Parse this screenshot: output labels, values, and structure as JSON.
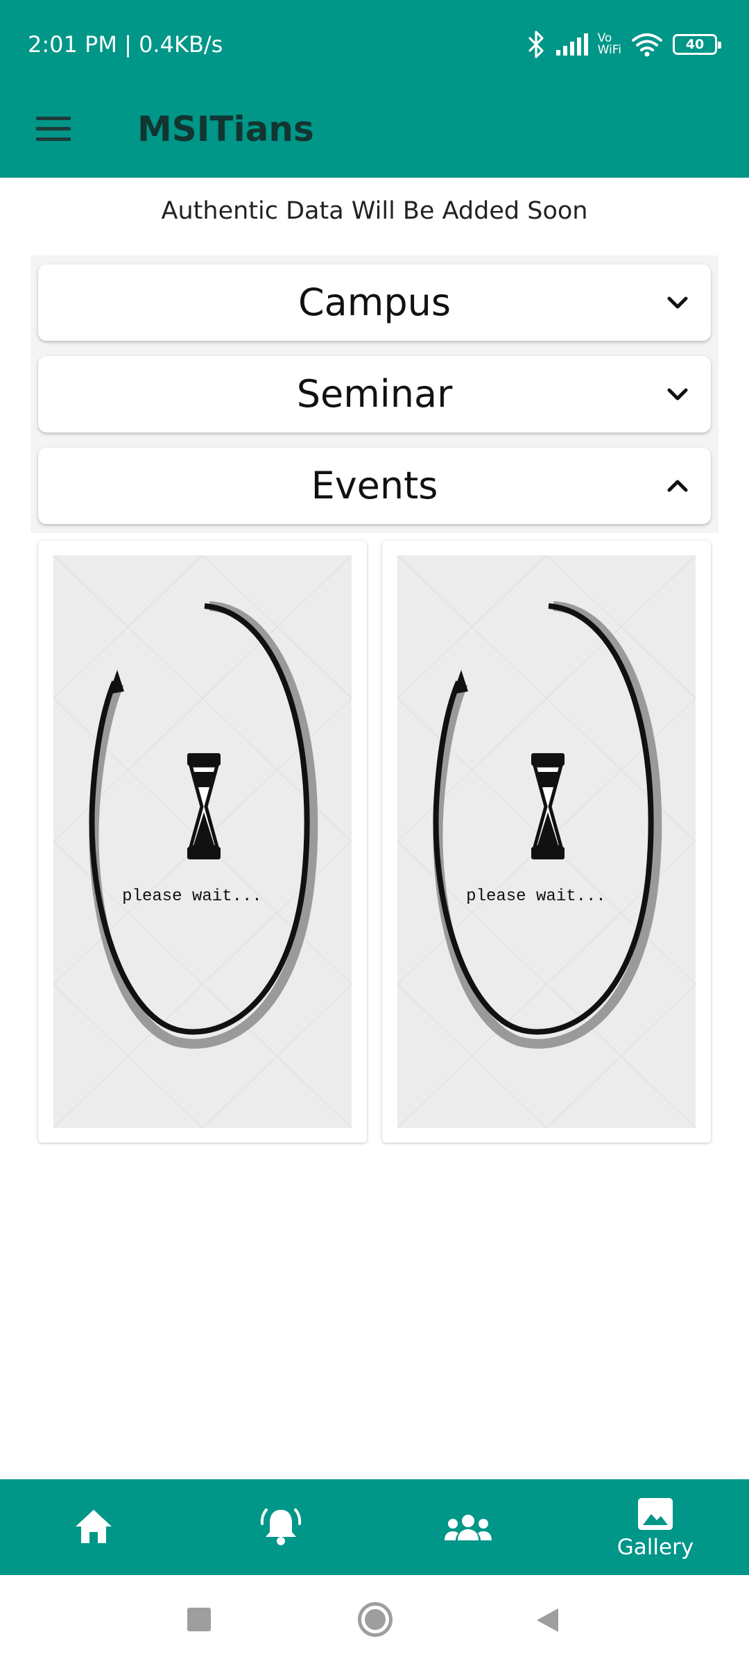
{
  "status_bar": {
    "time_speed": "2:01 PM | 0.4KB/s",
    "vowifi_top": "Vo",
    "vowifi_bottom": "WiFi",
    "battery": "40",
    "icons": [
      "bluetooth-icon",
      "signal-icon",
      "vowifi-icon",
      "wifi-icon",
      "battery-icon"
    ]
  },
  "app_bar": {
    "title": "MSITians",
    "menu_icon": "menu-icon"
  },
  "notice": "Authentic Data Will Be Added Soon",
  "accordion": [
    {
      "label": "Campus",
      "state": "collapsed",
      "icon": "chevron-down-icon"
    },
    {
      "label": "Seminar",
      "state": "collapsed",
      "icon": "chevron-down-icon"
    },
    {
      "label": "Events",
      "state": "expanded",
      "icon": "chevron-up-icon"
    }
  ],
  "gallery": [
    {
      "placeholder_text": "please wait..."
    },
    {
      "placeholder_text": "please wait..."
    }
  ],
  "bottom_nav": {
    "items": [
      {
        "icon": "home-icon",
        "label": ""
      },
      {
        "icon": "notification-bell-icon",
        "label": ""
      },
      {
        "icon": "people-icon",
        "label": ""
      },
      {
        "icon": "gallery-icon",
        "label": "Gallery",
        "active": true
      }
    ]
  },
  "colors": {
    "primary": "#009688",
    "surface": "#ffffff",
    "text": "#111111"
  }
}
